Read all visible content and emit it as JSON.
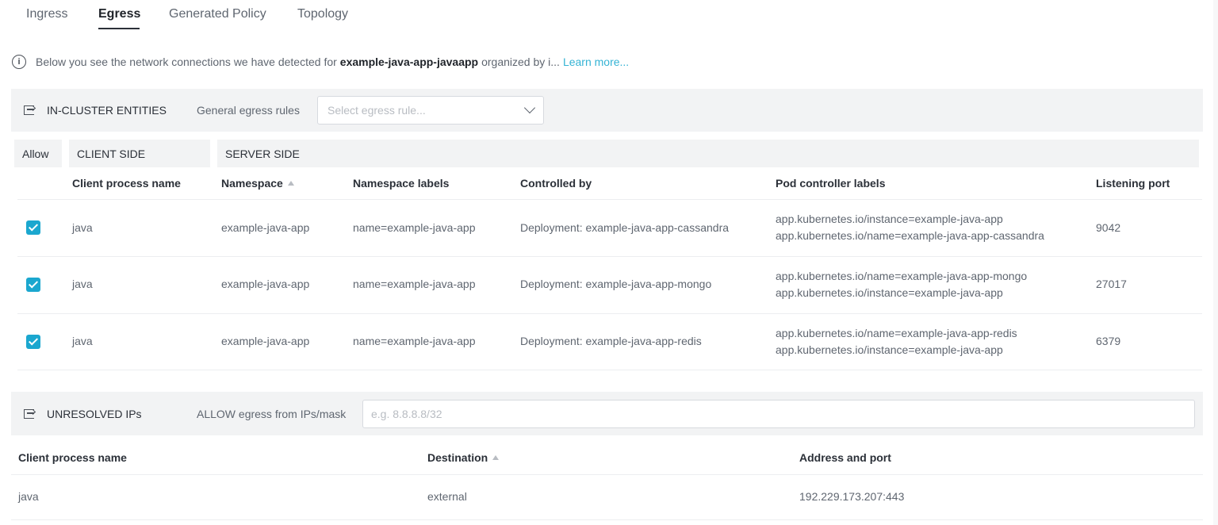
{
  "tabs": [
    "Ingress",
    "Egress",
    "Generated Policy",
    "Topology"
  ],
  "active_tab": "Egress",
  "info": {
    "icon": "info-icon",
    "prefix": "Below you see the network connections we have detected for",
    "app_name": "example-java-app-javaapp",
    "suffix": "organized by i...",
    "learn_more": "Learn more..."
  },
  "in_cluster": {
    "title": "IN-CLUSTER ENTITIES",
    "rules_label": "General egress rules",
    "rules_placeholder": "Select egress rule...",
    "group_allow": "Allow",
    "group_client": "CLIENT SIDE",
    "group_server": "SERVER SIDE",
    "columns": {
      "client_process": "Client process name",
      "namespace": "Namespace",
      "namespace_labels": "Namespace labels",
      "controlled_by": "Controlled by",
      "pod_labels": "Pod controller labels",
      "listening_port": "Listening port"
    },
    "rows": [
      {
        "allowed": true,
        "client_process": "java",
        "namespace": "example-java-app",
        "namespace_labels": "name=example-java-app",
        "controlled_by": "Deployment: example-java-app-cassandra",
        "pod_labels": [
          "app.kubernetes.io/instance=example-java-app",
          "app.kubernetes.io/name=example-java-app-cassandra"
        ],
        "port": "9042"
      },
      {
        "allowed": true,
        "client_process": "java",
        "namespace": "example-java-app",
        "namespace_labels": "name=example-java-app",
        "controlled_by": "Deployment: example-java-app-mongo",
        "pod_labels": [
          "app.kubernetes.io/name=example-java-app-mongo",
          "app.kubernetes.io/instance=example-java-app"
        ],
        "port": "27017"
      },
      {
        "allowed": true,
        "client_process": "java",
        "namespace": "example-java-app",
        "namespace_labels": "name=example-java-app",
        "controlled_by": "Deployment: example-java-app-redis",
        "pod_labels": [
          "app.kubernetes.io/name=example-java-app-redis",
          "app.kubernetes.io/instance=example-java-app"
        ],
        "port": "6379"
      }
    ]
  },
  "unresolved": {
    "title": "UNRESOLVED IPs",
    "allow_label": "ALLOW egress from IPs/mask",
    "ip_placeholder": "e.g. 8.8.8.8/32",
    "columns": {
      "client_process": "Client process name",
      "destination": "Destination",
      "address_port": "Address and port"
    },
    "rows": [
      {
        "client_process": "java",
        "destination": "external",
        "address_port": "192.229.173.207:443"
      }
    ]
  },
  "colors": {
    "accent": "#1ba7cf",
    "link": "#34b3d4",
    "section_bg": "#f2f3f4"
  }
}
